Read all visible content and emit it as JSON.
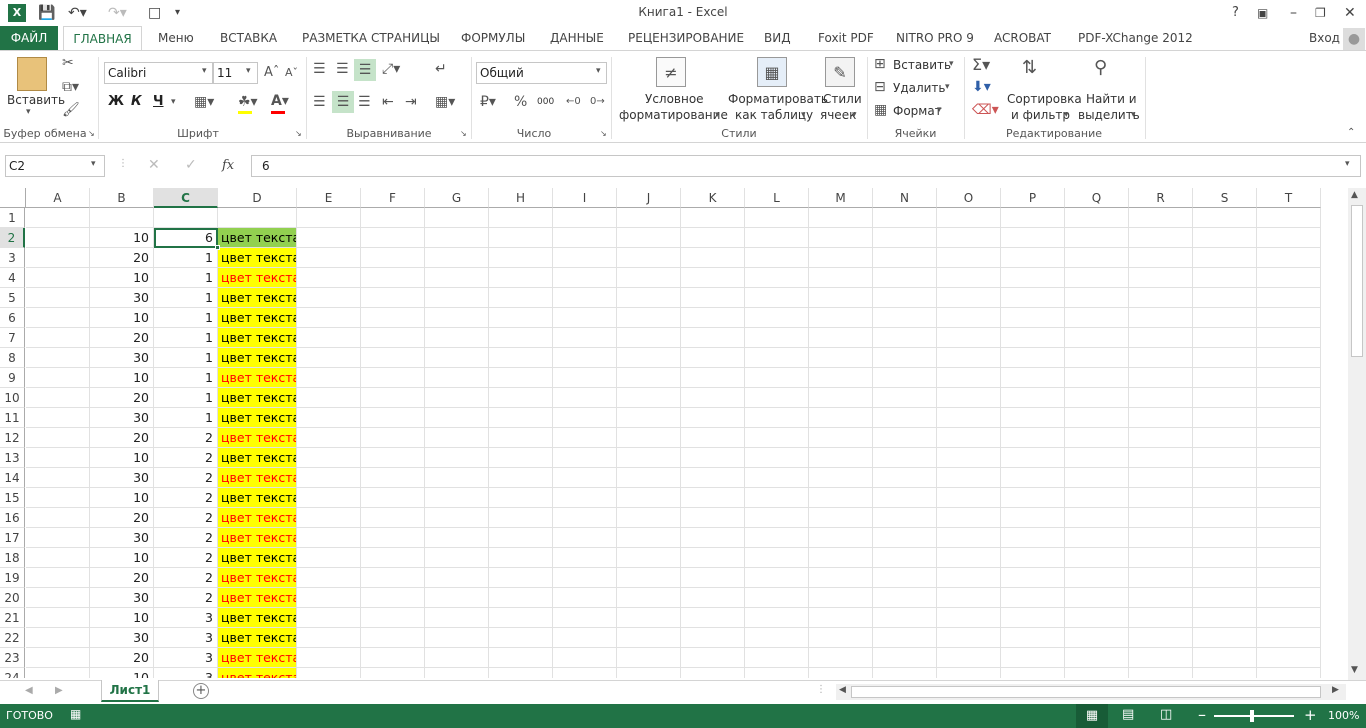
{
  "window": {
    "title": "Книга1 - Excel",
    "help": "?",
    "signin": "Вход"
  },
  "tabs": [
    "ФАЙЛ",
    "ГЛАВНАЯ",
    "Меню",
    "ВСТАВКА",
    "РАЗМЕТКА СТРАНИЦЫ",
    "ФОРМУЛЫ",
    "ДАННЫЕ",
    "РЕЦЕНЗИРОВАНИЕ",
    "ВИД",
    "Foxit PDF",
    "NITRO PRO 9",
    "ACROBAT",
    "PDF-XChange 2012"
  ],
  "ribbon": {
    "paste_label": "Вставить",
    "font_name": "Calibri",
    "font_size": "11",
    "bold": "Ж",
    "italic": "К",
    "underline": "Ч",
    "number_format": "Общий",
    "cond_format_1": "Условное",
    "cond_format_2": "форматирование",
    "format_table_1": "Форматировать",
    "format_table_2": "как таблицу",
    "cell_styles_1": "Стили",
    "cell_styles_2": "ячеек",
    "insert": "Вставить",
    "delete": "Удалить",
    "format": "Формат",
    "sort_1": "Сортировка",
    "sort_2": "и фильтр",
    "find_1": "Найти и",
    "find_2": "выделить",
    "groups": [
      "Буфер обмена",
      "Шрифт",
      "Выравнивание",
      "Число",
      "Стили",
      "Ячейки",
      "Редактирование"
    ]
  },
  "formula_bar": {
    "name_box": "C2",
    "fx": "fx",
    "value": "6"
  },
  "columns": [
    "A",
    "B",
    "C",
    "D",
    "E",
    "F",
    "G",
    "H",
    "I",
    "J",
    "K",
    "L",
    "M",
    "N",
    "O",
    "P",
    "Q",
    "R",
    "S",
    "T"
  ],
  "rows": [
    {
      "n": "1",
      "b": "",
      "c": "",
      "d": "",
      "d_color": ""
    },
    {
      "n": "2",
      "b": "10",
      "c": "6",
      "d": "цвет текста",
      "d_color": "green"
    },
    {
      "n": "3",
      "b": "20",
      "c": "1",
      "d": "цвет текста",
      "d_color": "black"
    },
    {
      "n": "4",
      "b": "10",
      "c": "1",
      "d": "цвет текста",
      "d_color": "red"
    },
    {
      "n": "5",
      "b": "30",
      "c": "1",
      "d": "цвет текста",
      "d_color": "black"
    },
    {
      "n": "6",
      "b": "10",
      "c": "1",
      "d": "цвет текста",
      "d_color": "black"
    },
    {
      "n": "7",
      "b": "20",
      "c": "1",
      "d": "цвет текста",
      "d_color": "black"
    },
    {
      "n": "8",
      "b": "30",
      "c": "1",
      "d": "цвет текста",
      "d_color": "black"
    },
    {
      "n": "9",
      "b": "10",
      "c": "1",
      "d": "цвет текста",
      "d_color": "red"
    },
    {
      "n": "10",
      "b": "20",
      "c": "1",
      "d": "цвет текста",
      "d_color": "black"
    },
    {
      "n": "11",
      "b": "30",
      "c": "1",
      "d": "цвет текста",
      "d_color": "black"
    },
    {
      "n": "12",
      "b": "20",
      "c": "2",
      "d": "цвет текста",
      "d_color": "red"
    },
    {
      "n": "13",
      "b": "10",
      "c": "2",
      "d": "цвет текста",
      "d_color": "black"
    },
    {
      "n": "14",
      "b": "30",
      "c": "2",
      "d": "цвет текста",
      "d_color": "red"
    },
    {
      "n": "15",
      "b": "10",
      "c": "2",
      "d": "цвет текста",
      "d_color": "black"
    },
    {
      "n": "16",
      "b": "20",
      "c": "2",
      "d": "цвет текста",
      "d_color": "red"
    },
    {
      "n": "17",
      "b": "30",
      "c": "2",
      "d": "цвет текста",
      "d_color": "red"
    },
    {
      "n": "18",
      "b": "10",
      "c": "2",
      "d": "цвет текста",
      "d_color": "black"
    },
    {
      "n": "19",
      "b": "20",
      "c": "2",
      "d": "цвет текста",
      "d_color": "red"
    },
    {
      "n": "20",
      "b": "30",
      "c": "2",
      "d": "цвет текста",
      "d_color": "red"
    },
    {
      "n": "21",
      "b": "10",
      "c": "3",
      "d": "цвет текста",
      "d_color": "black"
    },
    {
      "n": "22",
      "b": "30",
      "c": "3",
      "d": "цвет текста",
      "d_color": "black"
    },
    {
      "n": "23",
      "b": "20",
      "c": "3",
      "d": "цвет текста",
      "d_color": "red"
    },
    {
      "n": "24",
      "b": "10",
      "c": "3",
      "d": "цвет текста",
      "d_color": "red"
    }
  ],
  "colors": {
    "accent": "#217346",
    "cell_yellow": "#ffff00",
    "cell_green": "#92d050",
    "red_text": "#ff0000"
  },
  "sheet_tab": "Лист1",
  "status": {
    "ready": "ГОТОВО",
    "zoom": "100%"
  }
}
